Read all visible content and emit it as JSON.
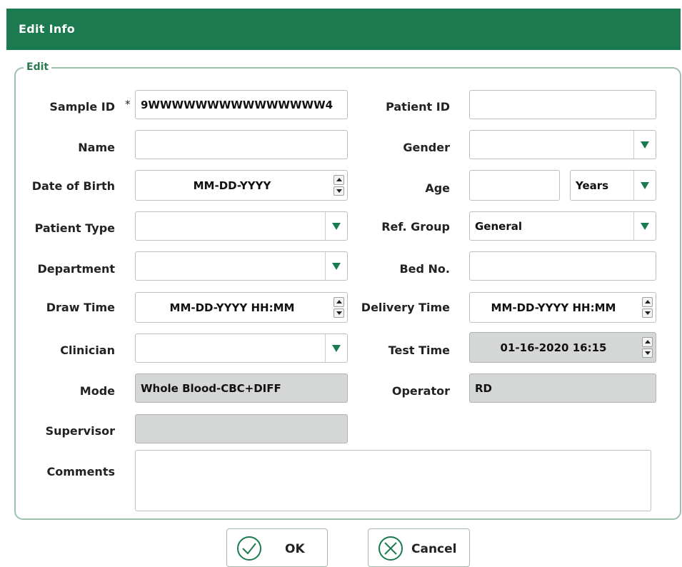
{
  "window": {
    "title": "Edit Info"
  },
  "group": {
    "legend": "Edit"
  },
  "labels": {
    "sample_id": "Sample ID",
    "required_mark": "*",
    "patient_id": "Patient ID",
    "name": "Name",
    "gender": "Gender",
    "date_of_birth": "Date of Birth",
    "age": "Age",
    "patient_type": "Patient Type",
    "ref_group": "Ref. Group",
    "department": "Department",
    "bed_no": "Bed No.",
    "draw_time": "Draw Time",
    "delivery_time": "Delivery Time",
    "clinician": "Clinician",
    "test_time": "Test Time",
    "mode": "Mode",
    "operator": "Operator",
    "supervisor": "Supervisor",
    "comments": "Comments"
  },
  "values": {
    "sample_id": "9WWWWWWWWWWWWWWW4",
    "patient_id": "",
    "name": "",
    "gender": "",
    "date_of_birth": "MM-DD-YYYY",
    "age": "",
    "age_unit": "Years",
    "patient_type": "",
    "ref_group": "General",
    "department": "",
    "bed_no": "",
    "draw_time": "MM-DD-YYYY HH:MM",
    "delivery_time": "MM-DD-YYYY HH:MM",
    "clinician": "",
    "test_time": "01-16-2020 16:15",
    "mode": "Whole Blood-CBC+DIFF",
    "operator": "RD",
    "supervisor": "",
    "comments": ""
  },
  "buttons": {
    "ok": "OK",
    "cancel": "Cancel"
  },
  "colors": {
    "header": "#1b7a4f",
    "accent": "#1b7a4f",
    "disabled_field": "#d4d7d5"
  },
  "icons": {
    "dropdown": "triangle-down-icon",
    "spin_up": "arrow-up-icon",
    "spin_down": "arrow-down-icon",
    "ok": "check-circle-icon",
    "cancel": "x-circle-icon"
  }
}
